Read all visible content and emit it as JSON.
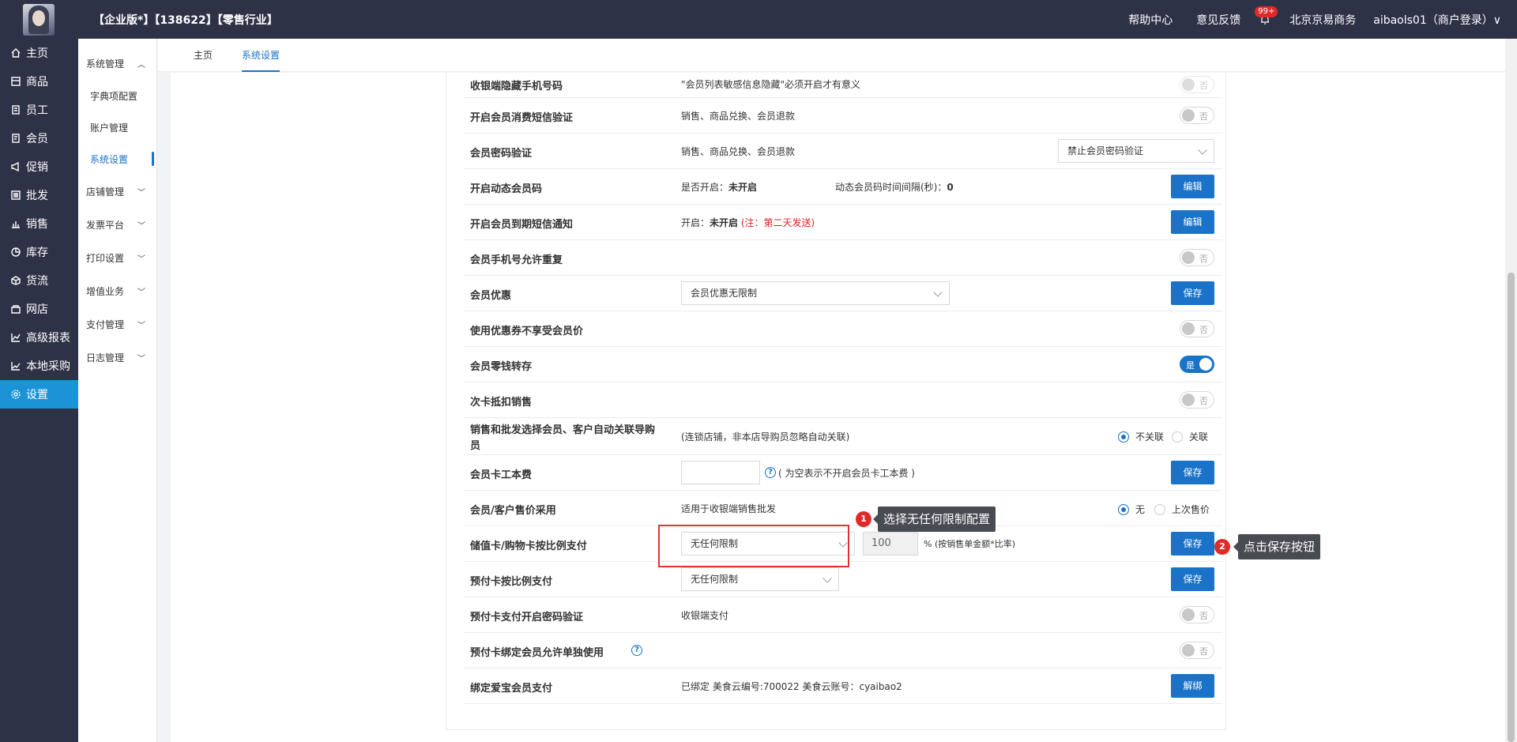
{
  "header": {
    "title": "【企业版*】【138622】【零售行业】",
    "help": "帮助中心",
    "feedback": "意见反馈",
    "bell_badge": "99+",
    "company": "北京京易商务",
    "user": "aibaols01（商户登录）∨"
  },
  "sidebar": {
    "items": [
      {
        "label": "主页",
        "icon": "home-icon"
      },
      {
        "label": "商品",
        "icon": "box-icon"
      },
      {
        "label": "员工",
        "icon": "staff-icon"
      },
      {
        "label": "会员",
        "icon": "member-icon"
      },
      {
        "label": "促销",
        "icon": "megaphone-icon"
      },
      {
        "label": "批发",
        "icon": "list-icon"
      },
      {
        "label": "销售",
        "icon": "bar-chart-icon"
      },
      {
        "label": "库存",
        "icon": "pie-icon"
      },
      {
        "label": "货流",
        "icon": "cube-icon"
      },
      {
        "label": "网店",
        "icon": "shop-icon"
      },
      {
        "label": "高级报表",
        "icon": "line-chart-icon"
      },
      {
        "label": "本地采购",
        "icon": "trend-icon"
      },
      {
        "label": "设置",
        "icon": "gear-icon"
      }
    ]
  },
  "subnav": {
    "group1": "系统管理",
    "sub1": "字典项配置",
    "sub2": "账户管理",
    "sub3": "系统设置",
    "groups": [
      "店铺管理",
      "发票平台",
      "打印设置",
      "增值业务",
      "支付管理",
      "日志管理"
    ]
  },
  "tabs": {
    "home": "主页",
    "settings": "系统设置"
  },
  "rows": {
    "r1": {
      "label": "收银端隐藏手机号码",
      "desc": "\"会员列表敏感信息隐藏\"必须开启才有意义",
      "toggle": "否"
    },
    "r2": {
      "label": "开启会员消费短信验证",
      "desc": "销售、商品兑换、会员退款",
      "toggle": "否"
    },
    "r3": {
      "label": "会员密码验证",
      "desc": "销售、商品兑换、会员退款",
      "select": "禁止会员密码验证"
    },
    "r4": {
      "label": "开启动态会员码",
      "desc1_key": "是否开启：",
      "desc1_val": "未开启",
      "desc2_key": "动态会员码时间间隔(秒)：",
      "desc2_val": "0",
      "btn": "编辑"
    },
    "r5": {
      "label": "开启会员到期短信通知",
      "desc_key": "开启：",
      "desc_val": "未开启",
      "note": "(注：第二天发送)",
      "btn": "编辑"
    },
    "r6": {
      "label": "会员手机号允许重复",
      "toggle": "否"
    },
    "r7": {
      "label": "会员优惠",
      "select": "会员优惠无限制",
      "btn": "保存"
    },
    "r8": {
      "label": "使用优惠券不享受会员价",
      "toggle": "否"
    },
    "r9": {
      "label": "会员零钱转存",
      "toggle": "是"
    },
    "r10": {
      "label": "次卡抵扣销售",
      "toggle": "否"
    },
    "r11": {
      "label1": "销售和批发选择会员、客户自动关联导购",
      "label2": "员",
      "desc": "(连锁店铺，非本店导购员忽略自动关联)",
      "radio1": "不关联",
      "radio2": "关联"
    },
    "r12": {
      "label": "会员卡工本费",
      "input": "",
      "hint": "( 为空表示不开启会员卡工本费 )",
      "btn": "保存"
    },
    "r13": {
      "label": "会员/客户售价采用",
      "desc": "适用于收银端销售批发",
      "radio1": "无",
      "radio2": "上次售价"
    },
    "r14": {
      "label": "储值卡/购物卡按比例支付",
      "select": "无任何限制",
      "input": "100",
      "hint": "% (按销售单金额*比率)",
      "btn": "保存"
    },
    "r15": {
      "label": "预付卡按比例支付",
      "select": "无任何限制",
      "btn": "保存"
    },
    "r16": {
      "label": "预付卡支付开启密码验证",
      "desc": "收银端支付",
      "toggle": "否"
    },
    "r17": {
      "label": "预付卡绑定会员允许单独使用",
      "toggle": "否"
    },
    "r18": {
      "label": "绑定爱宝会员支付",
      "desc": "已绑定 美食云编号:700022 美食云账号：cyaibao2",
      "btn": "解绑"
    }
  },
  "annotations": {
    "step1": "1",
    "tip1": "选择无任何限制配置",
    "step2": "2",
    "tip2": "点击保存按钮"
  },
  "colors": {
    "accent": "#1a73c8",
    "sidebar_bg": "#2e3247",
    "active_side": "#1c93d6",
    "warning": "#e02020"
  }
}
